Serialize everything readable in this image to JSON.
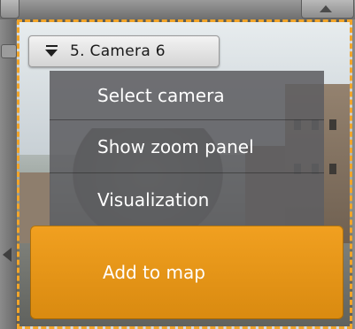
{
  "camera": {
    "title": "5. Camera 6"
  },
  "context_menu": {
    "items": [
      {
        "label": "Select camera"
      },
      {
        "label": "Show zoom panel"
      },
      {
        "label": "Visualization"
      },
      {
        "label": "Add to map",
        "highlighted": true
      }
    ]
  },
  "colors": {
    "selection_border": "#f2a52a",
    "highlight": "#e8961a",
    "menu_bg": "#5f5f62",
    "menu_text": "#ffffff"
  },
  "icons": {
    "camera_menu": "menu-dropdown-icon",
    "scroll_left": "arrow-left-icon",
    "scroll_up": "arrow-up-icon"
  }
}
